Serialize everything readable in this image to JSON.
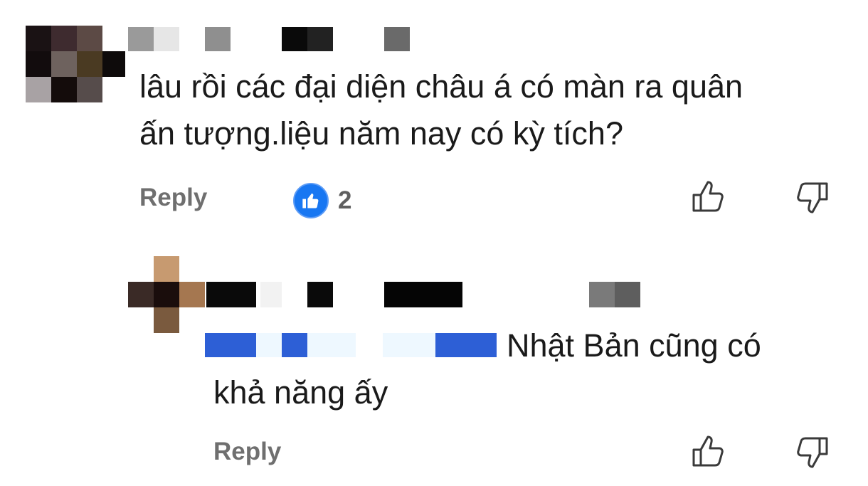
{
  "comments": [
    {
      "text_line1": "lâu rồi các đại diện châu á có màn ra quân",
      "text_line2": "ấn tượng.liệu năm nay có kỳ tích?",
      "reply_label": "Reply",
      "reaction_count": "2",
      "reaction_icon": "thumbs-up-icon",
      "like_icon": "thumbs-up-outline-icon",
      "dislike_icon": "thumbs-down-outline-icon"
    },
    {
      "text_line1": "Nhật Bản cũng có",
      "text_line2": "khả năng ấy",
      "reply_label": "Reply",
      "like_icon": "thumbs-up-outline-icon",
      "dislike_icon": "thumbs-down-outline-icon"
    }
  ],
  "colors": {
    "accent": "#1877f2",
    "mention": "#2d5fd6",
    "muted": "#6f6f6f"
  }
}
